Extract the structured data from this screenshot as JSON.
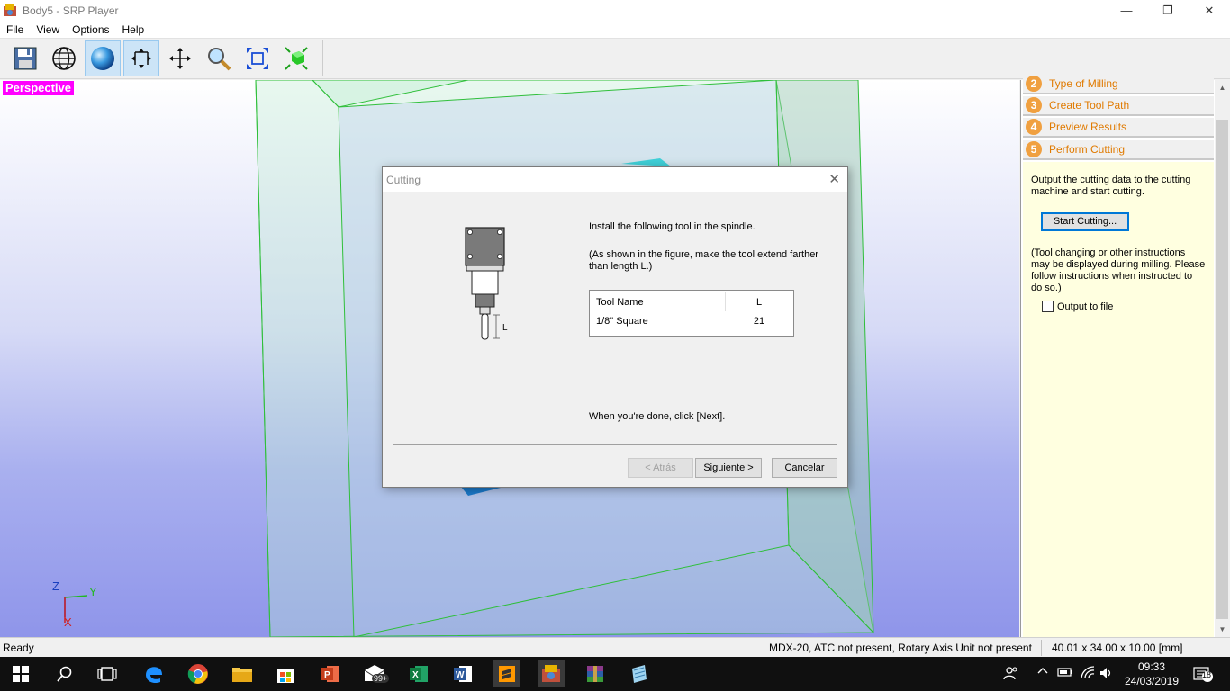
{
  "window": {
    "title": "Body5 - SRP Player",
    "minimize": "—",
    "restore": "❐",
    "close": "✕"
  },
  "menu": [
    "File",
    "View",
    "Options",
    "Help"
  ],
  "toolbar": {
    "buttons": [
      {
        "name": "save",
        "icon": "floppy-icon"
      },
      {
        "name": "wireframe",
        "icon": "globe-wireframe-icon"
      },
      {
        "name": "solid",
        "icon": "sphere-icon",
        "active": true
      },
      {
        "name": "rotate",
        "icon": "rotate-icon",
        "active": true
      },
      {
        "name": "pan",
        "icon": "move-icon"
      },
      {
        "name": "zoom",
        "icon": "magnifier-icon"
      },
      {
        "name": "fit",
        "icon": "fit-view-icon"
      },
      {
        "name": "zoom-to-model",
        "icon": "zoom-model-icon"
      }
    ]
  },
  "viewport": {
    "label": "Perspective",
    "axes": {
      "z": "Z",
      "y": "Y",
      "x": "X"
    }
  },
  "panel": {
    "steps": [
      {
        "num": "2",
        "label": "Type of Milling"
      },
      {
        "num": "3",
        "label": "Create Tool Path"
      },
      {
        "num": "4",
        "label": "Preview Results"
      },
      {
        "num": "5",
        "label": "Perform Cutting"
      }
    ],
    "content": {
      "intro": "Output the cutting data to the cutting machine and start cutting.",
      "start_button": "Start Cutting...",
      "note": "(Tool changing or other instructions may be displayed during milling. Please follow instructions when instructed to do so.)",
      "output_to_file": "Output to file"
    }
  },
  "status": {
    "ready": "Ready",
    "machine": "MDX-20, ATC not present, Rotary Axis Unit not present",
    "size": "40.01 x  34.00 x  10.00 [mm]"
  },
  "dialog": {
    "title": "Cutting",
    "close": "✕",
    "instruction": "Install the following tool in the spindle.",
    "note": "(As shown in the figure, make the tool extend farther than length L.)",
    "table": {
      "headers": [
        "Tool Name",
        "L"
      ],
      "rows": [
        [
          "1/8\" Square",
          "21"
        ]
      ]
    },
    "figure_label": "L",
    "done_text": "When you're done, click [Next].",
    "buttons": {
      "back": "< Atrás",
      "next": "Siguiente >",
      "cancel": "Cancelar"
    }
  },
  "taskbar": {
    "badge": "99+",
    "time": "09:33",
    "date": "24/03/2019",
    "notifications": "18"
  },
  "colors": {
    "accent": "#0078d7",
    "view_label_bg": "#ff00ff",
    "step_orange": "#e07a00",
    "panel_content_bg": "#ffffe0"
  }
}
